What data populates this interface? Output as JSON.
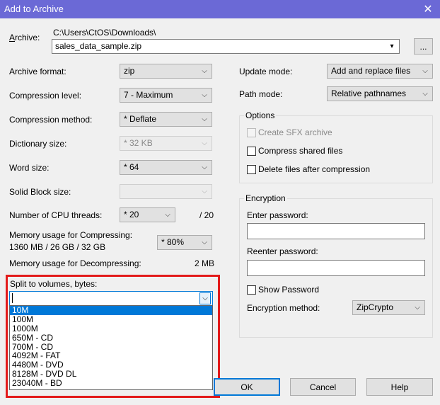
{
  "window": {
    "title": "Add to Archive",
    "close_glyph": "✕"
  },
  "archive": {
    "label": "Archive:",
    "path": "C:\\Users\\CtOS\\Downloads\\",
    "filename": "sales_data_sample.zip",
    "browse_label": "..."
  },
  "left": {
    "archive_format": {
      "label": "Archive format:",
      "value": "zip"
    },
    "compression_level": {
      "label": "Compression level:",
      "value": "7 - Maximum"
    },
    "compression_method": {
      "label": "Compression method:",
      "value": "*  Deflate"
    },
    "dictionary_size": {
      "label": "Dictionary size:",
      "value": "*  32 KB"
    },
    "word_size": {
      "label": "Word size:",
      "value": "*  64"
    },
    "solid_block_size": {
      "label": "Solid Block size:",
      "value": ""
    },
    "cpu_threads": {
      "label": "Number of CPU threads:",
      "value": "*  20",
      "max": "/ 20"
    },
    "memory_compress": {
      "label": "Memory usage for Compressing:",
      "detail": "1360 MB / 26 GB / 32 GB",
      "value": "*  80%"
    },
    "memory_decompress": {
      "label": "Memory usage for Decompressing:",
      "value": "2 MB"
    },
    "split": {
      "label": "Split to volumes, bytes:",
      "value": "",
      "options": [
        "10M",
        "100M",
        "1000M",
        "650M - CD",
        "700M - CD",
        "4092M - FAT",
        "4480M - DVD",
        "8128M - DVD DL",
        "23040M - BD"
      ],
      "selected_index": 0
    }
  },
  "right": {
    "update_mode": {
      "label": "Update mode:",
      "value": "Add and replace files"
    },
    "path_mode": {
      "label": "Path mode:",
      "value": "Relative pathnames"
    },
    "options": {
      "title": "Options",
      "create_sfx": "Create SFX archive",
      "compress_shared": "Compress shared files",
      "delete_after": "Delete files after compression"
    },
    "encryption": {
      "title": "Encryption",
      "enter_password": "Enter password:",
      "reenter_password": "Reenter password:",
      "show_password": "Show Password",
      "method_label": "Encryption method:",
      "method_value": "ZipCrypto"
    }
  },
  "buttons": {
    "ok": "OK",
    "cancel": "Cancel",
    "help": "Help"
  },
  "colors": {
    "titlebar": "#6b69d6",
    "selection": "#0078d7",
    "highlight": "#e31b1b"
  },
  "icons": {
    "dropdown_arrow": "▾",
    "dropdown_arrow_outline": "⌵"
  }
}
